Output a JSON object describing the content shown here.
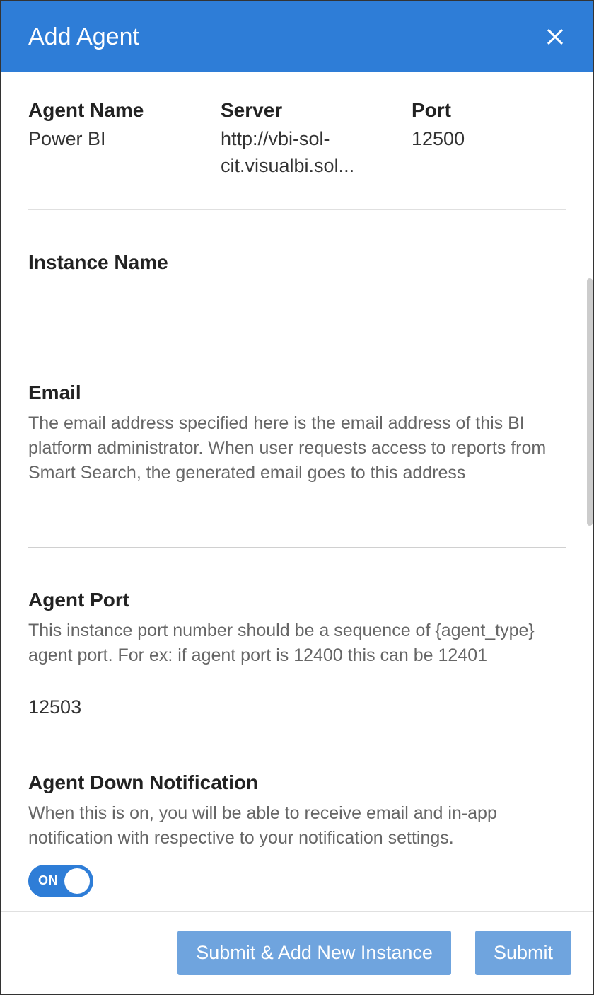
{
  "header": {
    "title": "Add Agent"
  },
  "summary": {
    "agent_name_label": "Agent Name",
    "agent_name_value": "Power BI",
    "server_label": "Server",
    "server_value": "http://vbi-sol-cit.visualbi.sol...",
    "port_label": "Port",
    "port_value": "12500"
  },
  "form": {
    "instance_name_label": "Instance Name",
    "instance_name_value": "",
    "email_label": "Email",
    "email_desc": "The email address specified here is the email address of this BI platform administrator. When user requests access to reports from Smart Search, the generated email goes to this address",
    "email_value": "",
    "agent_port_label": "Agent Port",
    "agent_port_desc": "This instance port number should be a sequence of {agent_type} agent port. For ex: if agent port is 12400 this can be 12401",
    "agent_port_value": "12503",
    "notification_label": "Agent Down Notification",
    "notification_desc": "When this is on, you will be able to receive email and in-app notification with respective to your notification settings.",
    "notification_toggle_label": "ON"
  },
  "footer": {
    "submit_new_label": "Submit & Add New Instance",
    "submit_label": "Submit"
  }
}
